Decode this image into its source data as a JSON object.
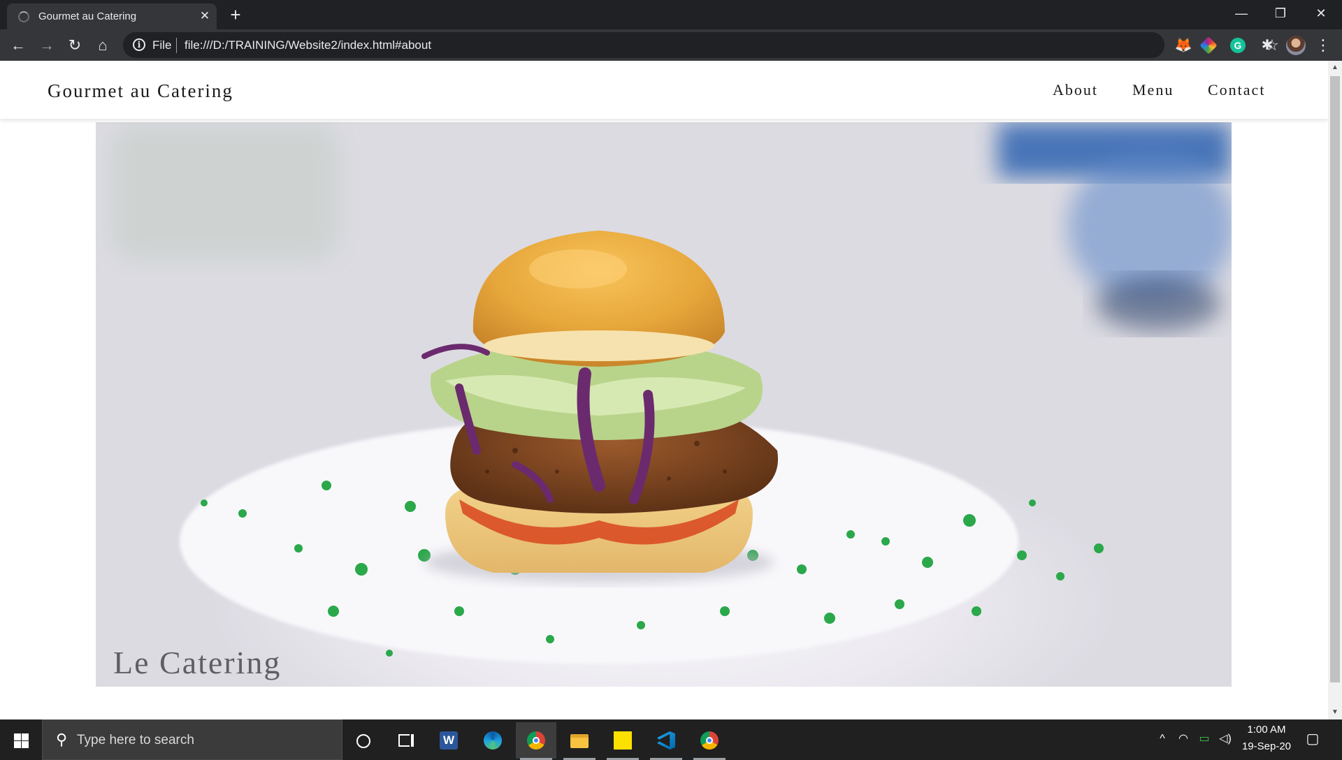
{
  "browser": {
    "tab_title": "Gourmet au Catering",
    "tab_close": "✕",
    "new_tab": "+",
    "window_controls": {
      "minimize": "—",
      "restore": "❐",
      "close": "✕"
    },
    "nav": {
      "back": "←",
      "forward": "→",
      "reload": "↻",
      "home": "⌂"
    },
    "address": {
      "info": "i",
      "scheme_label": "File",
      "url": "file:///D:/TRAINING/Website2/index.html#about"
    },
    "bookmark_star": "☆",
    "extensions": [
      {
        "name": "metamask-extension-icon",
        "glyph": "🦊",
        "color": "#f6851b"
      },
      {
        "name": "colorpick-extension-icon",
        "glyph": "◆",
        "color": "#e53935"
      },
      {
        "name": "grammarly-extension-icon",
        "glyph": "G",
        "color": "#15c39a"
      },
      {
        "name": "extensions-puzzle-icon",
        "glyph": "✱",
        "color": "#e8eaed"
      }
    ],
    "menu": "⋮"
  },
  "site": {
    "brand": "Gourmet au Catering",
    "nav": {
      "about": "About",
      "menu": "Menu",
      "contact": "Contact"
    },
    "hero_caption": "Le Catering"
  },
  "scrollbar": {
    "up": "▲",
    "down": "▼"
  },
  "taskbar": {
    "search_placeholder": "Type here to search",
    "search_icon": "⚲",
    "apps": [
      {
        "name": "cortana-icon"
      },
      {
        "name": "task-view-icon"
      },
      {
        "name": "word-icon"
      },
      {
        "name": "edge-icon"
      },
      {
        "name": "chrome-icon",
        "active": true
      },
      {
        "name": "file-explorer-icon"
      },
      {
        "name": "sticky-notes-icon"
      },
      {
        "name": "vscode-icon"
      },
      {
        "name": "chrome-icon-2"
      }
    ],
    "tray": {
      "chevron": "^",
      "network": "◠",
      "battery": "▭",
      "volume": "◁)",
      "time": "1:00 AM",
      "date": "19-Sep-20",
      "notifications": "▢"
    }
  },
  "colors": {
    "chrome_dark": "#202124",
    "chrome_toolbar": "#35363a",
    "taskbar": "#202020",
    "bun": "#e6a63a",
    "patty": "#8a4a22",
    "cabbage": "#6b2a6e",
    "lettuce": "#b8d48a",
    "chive": "#2aa84a"
  }
}
